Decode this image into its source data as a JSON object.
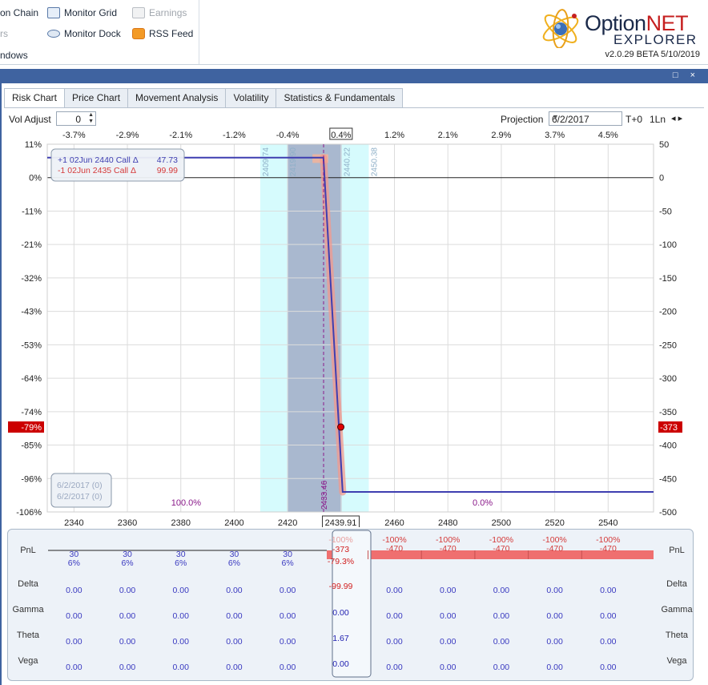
{
  "ribbon": {
    "items": [
      {
        "label": "on Chain",
        "icon": "option-chain-icon",
        "disabled": false
      },
      {
        "label": "Monitor Grid",
        "icon": "monitor-grid-icon",
        "disabled": false
      },
      {
        "label": "Earnings",
        "icon": "earnings-icon",
        "disabled": true
      },
      {
        "label": "rs",
        "icon": "",
        "disabled": true
      },
      {
        "label": "Monitor Dock",
        "icon": "eye-icon",
        "disabled": false
      },
      {
        "label": "RSS Feed",
        "icon": "rss-icon",
        "disabled": false
      }
    ],
    "group_label": "ndows",
    "logo": {
      "option": "Option",
      "net": "NET",
      "explorer": "EXPLORER",
      "version": "v2.0.29 BETA 5/10/2019"
    }
  },
  "panel": {
    "buttons": "□ ×"
  },
  "tabs": [
    "Risk Chart",
    "Price Chart",
    "Movement Analysis",
    "Volatility",
    "Statistics & Fundamentals"
  ],
  "controls": {
    "vol_adjust_label": "Vol Adjust",
    "vol_adjust_value": "0",
    "projection_label": "Projection",
    "projection_date": "6/2/2017",
    "t_label": "T+0",
    "ln_label": "1Ln",
    "nav_arrows": "◂ ▸"
  },
  "chart_data": {
    "type": "line",
    "top_ticks": [
      "-3.7%",
      "-2.9%",
      "-2.1%",
      "-1.2%",
      "-0.4%",
      "0.4%",
      "1.2%",
      "2.1%",
      "2.9%",
      "3.7%",
      "4.5%"
    ],
    "top_tick_x": [
      2340,
      2360,
      2380,
      2400,
      2420,
      2440,
      2460,
      2480,
      2500,
      2520,
      2540
    ],
    "top_highlight": "0.4%",
    "x_ticks": [
      2340,
      2360,
      2380,
      2400,
      2420,
      2440,
      2460,
      2480,
      2500,
      2520,
      2540
    ],
    "x_highlight": "2439.91",
    "xlim": [
      2330,
      2557
    ],
    "left_ticks": [
      "11%",
      "0%",
      "-11%",
      "-21%",
      "-32%",
      "-43%",
      "-53%",
      "-64%",
      "-74%",
      "-85%",
      "-96%",
      "-106%"
    ],
    "right_ticks": [
      50,
      0,
      -50,
      -100,
      -150,
      -200,
      -250,
      -300,
      -350,
      -400,
      -450,
      -500
    ],
    "ylim": [
      -500,
      50
    ],
    "left_marker": "-79%",
    "right_marker": "-373",
    "bands": [
      {
        "from": 2409.74,
        "to": 2450.38,
        "color": "#d6fbfd"
      },
      {
        "from": 2419.9,
        "to": 2440.22,
        "color": "#a9b8cf"
      }
    ],
    "band_labels": [
      {
        "x": 2409.74,
        "text": "2409.74"
      },
      {
        "x": 2419.9,
        "text": "2419.90"
      },
      {
        "x": 2440.22,
        "text": "2440.22"
      },
      {
        "x": 2450.38,
        "text": "2450.38"
      }
    ],
    "dashed_line": {
      "x": 2433.46,
      "text": "2433.46"
    },
    "series": [
      {
        "points": [
          [
            2330,
            30
          ],
          [
            2433.4,
            30
          ],
          [
            2440.6,
            -470
          ],
          [
            2557,
            -470
          ]
        ],
        "color": "#3e3eb0"
      },
      {
        "points": [
          [
            2433.4,
            30
          ],
          [
            2440.6,
            -470
          ]
        ],
        "color": "#f39a8e"
      }
    ],
    "orange_box": [
      2429.3,
      2435.2,
      22,
      35
    ],
    "current_point": {
      "x": 2439.91,
      "y": -373
    },
    "probabilities": [
      {
        "x": 2382,
        "text": "100.0%"
      },
      {
        "x": 2493,
        "text": "0.0%"
      }
    ],
    "legend": [
      {
        "text": "+1 02Jun 2440 Call Δ",
        "value": "47.73",
        "color": "#3e3eb0"
      },
      {
        "text": "-1 02Jun 2435 Call Δ",
        "value": "99.99",
        "color": "#d53a3a"
      }
    ],
    "date_box": [
      "6/2/2017 (0)",
      "6/2/2017 (0)"
    ]
  },
  "grid": {
    "row_labels": [
      "PnL",
      "Delta",
      "Gamma",
      "Theta",
      "Vega"
    ],
    "columns": [
      {
        "x": 2340,
        "pct": "6%",
        "pnl": "30",
        "delta": "0.00",
        "gamma": "0.00",
        "theta": "0.00",
        "vega": "0.00"
      },
      {
        "x": 2360,
        "pct": "6%",
        "pnl": "30",
        "delta": "0.00",
        "gamma": "0.00",
        "theta": "0.00",
        "vega": "0.00"
      },
      {
        "x": 2380,
        "pct": "6%",
        "pnl": "30",
        "delta": "0.00",
        "gamma": "0.00",
        "theta": "0.00",
        "vega": "0.00"
      },
      {
        "x": 2400,
        "pct": "6%",
        "pnl": "30",
        "delta": "0.00",
        "gamma": "0.00",
        "theta": "0.00",
        "vega": "0.00"
      },
      {
        "x": 2420,
        "pct": "6%",
        "pnl": "30",
        "delta": "0.00",
        "gamma": "0.00",
        "theta": "0.00",
        "vega": "0.00"
      },
      {
        "x": 2460,
        "pct": "-100%",
        "pnl": "-470",
        "delta": "0.00",
        "gamma": "0.00",
        "theta": "0.00",
        "vega": "0.00"
      },
      {
        "x": 2480,
        "pct": "-100%",
        "pnl": "-470",
        "delta": "0.00",
        "gamma": "0.00",
        "theta": "0.00",
        "vega": "0.00"
      },
      {
        "x": 2500,
        "pct": "-100%",
        "pnl": "-470",
        "delta": "0.00",
        "gamma": "0.00",
        "theta": "0.00",
        "vega": "0.00"
      },
      {
        "x": 2520,
        "pct": "-100%",
        "pnl": "-470",
        "delta": "0.00",
        "gamma": "0.00",
        "theta": "0.00",
        "vega": "0.00"
      },
      {
        "x": 2540,
        "pct": "-100%",
        "pnl": "-470",
        "delta": "0.00",
        "gamma": "0.00",
        "theta": "0.00",
        "vega": "0.00"
      }
    ],
    "current": {
      "ghost_pct": "-100%",
      "pnl": "-373",
      "pct": "-79.3%",
      "delta": "-99.99",
      "gamma": "0.00",
      "theta": "1.67",
      "vega": "0.00"
    }
  }
}
